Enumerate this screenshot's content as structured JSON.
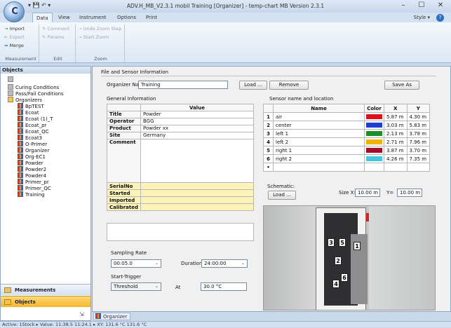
{
  "window": {
    "title": "ADV.H_MB_V2.3.1 mobil Training [Organizer] - temp-chart MB Version 2.3.1",
    "qat": "▾ 💾 ↶ ▾",
    "min": "–",
    "max": "☐",
    "close": "✕"
  },
  "tabs": [
    "Data",
    "View",
    "Instrument",
    "Options",
    "Print"
  ],
  "style_label": "Style ▾",
  "help": "?",
  "ribbon": {
    "measurement": {
      "title": "Measurement",
      "import": "Import",
      "export": "Export",
      "merge": "Merge"
    },
    "edit": {
      "title": "Edit",
      "comment": "Comment",
      "params": "Params"
    },
    "zoom": {
      "title": "Zoom",
      "undo": "Undo Zoom Step",
      "start": "Start Zoom"
    }
  },
  "objects": {
    "header": "Objects",
    "tree": [
      {
        "label": "Curing Conditions",
        "icon": "grey"
      },
      {
        "label": "Pass/Fail Conditions",
        "icon": "grey"
      },
      {
        "label": "Organizers",
        "icon": "fold"
      },
      {
        "label": "BpTEST"
      },
      {
        "label": "Ecoat"
      },
      {
        "label": "Ecoat (1)_T"
      },
      {
        "label": "Ecoat_pr"
      },
      {
        "label": "Ecoat_QC"
      },
      {
        "label": "Ecoat3"
      },
      {
        "label": "O-Primer"
      },
      {
        "label": "Organizer"
      },
      {
        "label": "Org-EC1"
      },
      {
        "label": "Powder"
      },
      {
        "label": "Powder2"
      },
      {
        "label": "Powder4"
      },
      {
        "label": "Primer_pr"
      },
      {
        "label": "Primer_QC"
      },
      {
        "label": "Training"
      }
    ],
    "nav_measurements": "Measurements",
    "nav_objects": "Objects"
  },
  "file": {
    "section": "File and Sensor Information",
    "organizer_label": "Organizer Name",
    "organizer_name": "Training",
    "load": "Load ...",
    "remove": "Remove",
    "save_as": "Save As"
  },
  "general": {
    "section": "General Information",
    "value_header": "Value",
    "rows": [
      {
        "k": "Title",
        "v": "Powder"
      },
      {
        "k": "Operator",
        "v": "BGG"
      },
      {
        "k": "Product",
        "v": "Powder xx"
      },
      {
        "k": "Site",
        "v": "Germany"
      },
      {
        "k": "Comment",
        "v": ""
      }
    ],
    "yellow_rows": [
      {
        "k": "SerialNo",
        "v": ""
      },
      {
        "k": "Started",
        "v": ""
      },
      {
        "k": "Imported",
        "v": ""
      },
      {
        "k": "Calibrated",
        "v": ""
      }
    ]
  },
  "sampling": {
    "rate_label": "Sampling Rate",
    "rate": "00:05.0",
    "duration_label": "Duration",
    "duration": "24:00:00",
    "start_label": "Start-Trigger",
    "trigger": "Threshold",
    "at_label": "At",
    "at_value": "30.0 °C"
  },
  "sensors": {
    "section": "Sensor name and location",
    "headers": [
      "Name",
      "Color",
      "X",
      "Y"
    ],
    "rows": [
      {
        "i": "1",
        "name": "air",
        "color": "#e0101b",
        "x": "5.87 m",
        "y": "4.30 m"
      },
      {
        "i": "2",
        "name": "center",
        "color": "#1d3fcf",
        "x": "3.03 m",
        "y": "5.83 m"
      },
      {
        "i": "3",
        "name": "left 1",
        "color": "#1a8f2a",
        "x": "2.13 m",
        "y": "3.78 m"
      },
      {
        "i": "4",
        "name": "left 2",
        "color": "#f1b300",
        "x": "2.71 m",
        "y": "7.96 m"
      },
      {
        "i": "5",
        "name": "right 1",
        "color": "#a50f25",
        "x": "3.87 m",
        "y": "3.70 m"
      },
      {
        "i": "6",
        "name": "right 2",
        "color": "#43c7e0",
        "x": "4.26 m",
        "y": "7.35 m"
      }
    ],
    "new_row": "•"
  },
  "schematic": {
    "label": "Schematic:",
    "load": "Load ...",
    "size_x_label": "Size X=",
    "size_x": "10.00 m",
    "y_label": "Y=",
    "size_y": "10.00 m",
    "markers": [
      "3",
      "5",
      "1",
      "2",
      "4",
      "6"
    ]
  },
  "doc_tab": "Organizer",
  "status": "Active: 1Stock    ▸  Value: 11:38.5 11:24.1    ▸  XY:  131.6 °C 131.6 °C"
}
